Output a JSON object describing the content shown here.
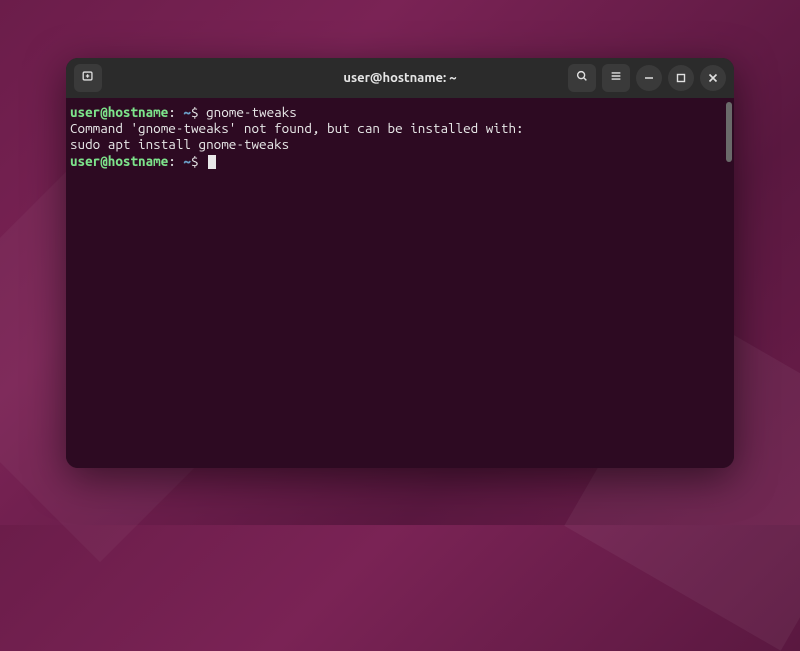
{
  "window": {
    "title": "user@hostname: ~"
  },
  "prompt": {
    "user_host": "user@hostname",
    "colon": ":",
    "path": " ~",
    "dollar": "$ "
  },
  "lines": {
    "cmd1": "gnome-tweaks",
    "out1": "Command 'gnome-tweaks' not found, but can be installed with:",
    "out2": "sudo apt install gnome-tweaks"
  },
  "colors": {
    "prompt_user": "#7de38b",
    "prompt_path": "#6aa0c8",
    "terminal_bg": "#2d0a22",
    "titlebar_bg": "#2b2b2b",
    "text": "#e8e8e8"
  },
  "icons": {
    "new_tab": "new-tab-icon",
    "search": "search-icon",
    "menu": "hamburger-icon",
    "minimize": "minimize-icon",
    "maximize": "maximize-icon",
    "close": "close-icon"
  }
}
